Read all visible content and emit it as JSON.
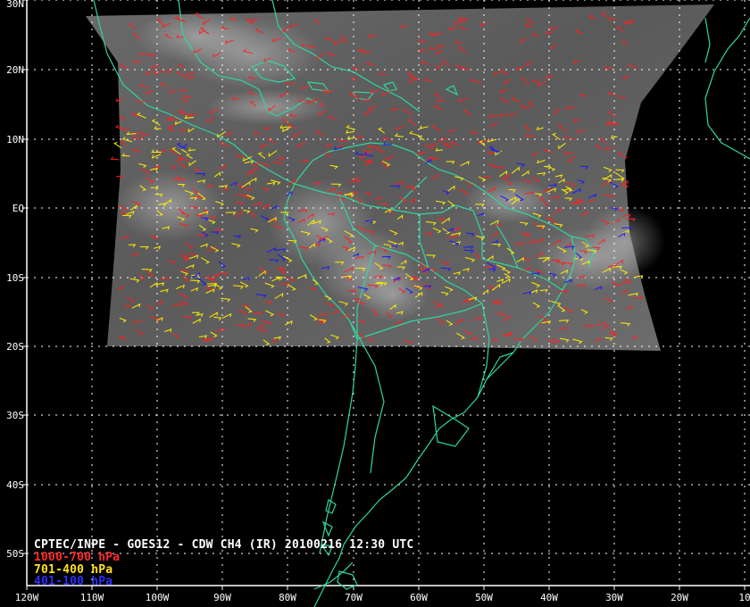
{
  "caption": {
    "title": "CPTEC/INPE - GOES12 - CDW CH4 (IR) 20100216 12:30 UTC",
    "low": "1000-700 hPa",
    "mid": "701-400 hPa",
    "high": "401-100 hPa"
  },
  "lat_labels": [
    "30N",
    "20N",
    "10N",
    "EQ",
    "10S",
    "20S",
    "30S",
    "40S",
    "50S"
  ],
  "lon_labels": [
    "120W",
    "110W",
    "100W",
    "90W",
    "80W",
    "70W",
    "60W",
    "50W",
    "40W",
    "30W",
    "20W",
    "10"
  ],
  "colors": {
    "background": "#000000",
    "coastline": "#2fd6a0",
    "grid": "#ffffff",
    "satellite_image": "#5c5c5c",
    "wind_low": "#ff2020",
    "wind_mid": "#ffee00",
    "wind_high": "#1a1aff"
  }
}
